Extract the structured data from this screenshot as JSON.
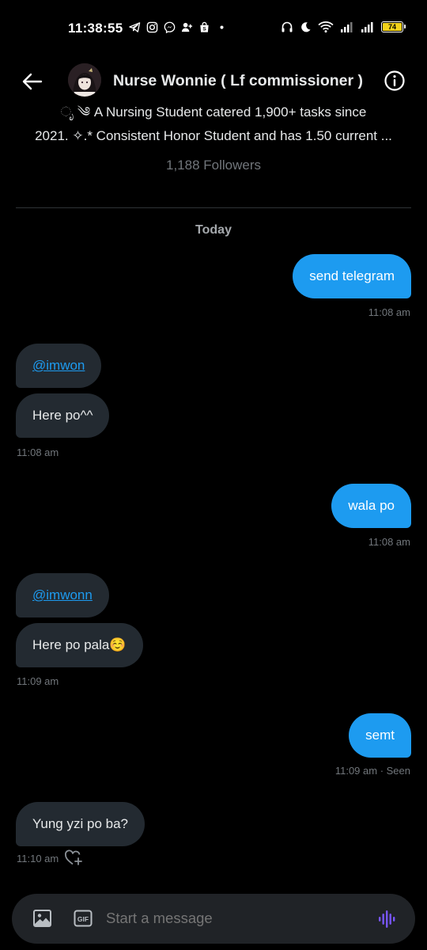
{
  "status_bar": {
    "time": "11:38:55",
    "battery": "74",
    "left_icons": [
      "telegram-icon",
      "instagram-icon",
      "messenger-icon",
      "person-add-icon",
      "shopee-icon",
      "dot-icon"
    ],
    "right_icons": [
      "headphones-icon",
      "moon-icon",
      "wifi-icon",
      "signal-icon",
      "signal-icon-2",
      "battery-icon"
    ]
  },
  "header": {
    "title": "Nurse Wonnie ( Lf commissioner )",
    "back_icon": "back-arrow-icon",
    "info_icon": "info-icon"
  },
  "profile": {
    "bio_line_1": "ೃ ༄ A Nursing Student catered 1,900+ tasks since",
    "bio_line_2": "2021. ✧.* Consistent Honor Student and has 1.50 current ...",
    "followers": "1,188 Followers"
  },
  "conversation": {
    "day_label": "Today",
    "messages": [
      {
        "dir": "out",
        "text": "send telegram",
        "time": "11:08 am"
      },
      {
        "dir": "in",
        "text": "@imwon",
        "mention": true
      },
      {
        "dir": "in",
        "text": "Here po^^",
        "time": "11:08 am"
      },
      {
        "dir": "out",
        "text": "wala po",
        "time": "11:08 am"
      },
      {
        "dir": "in",
        "text": "@imwonn",
        "mention": true
      },
      {
        "dir": "in",
        "text": "Here po pala☺️",
        "time": "11:09 am"
      },
      {
        "dir": "out",
        "text": "semt",
        "time": "11:09 am · Seen"
      },
      {
        "dir": "in",
        "text": "Yung yzi po ba?",
        "time": "11:10 am"
      }
    ]
  },
  "composer": {
    "placeholder": "Start a message",
    "image_icon": "image-icon",
    "gif_label": "GIF",
    "voice_icon": "voice-icon"
  },
  "colors": {
    "background": "#000000",
    "outgoing_bubble": "#1d9bf0",
    "incoming_bubble": "#232a31",
    "muted_text": "#71767b",
    "voice_accent": "#7856ff"
  }
}
